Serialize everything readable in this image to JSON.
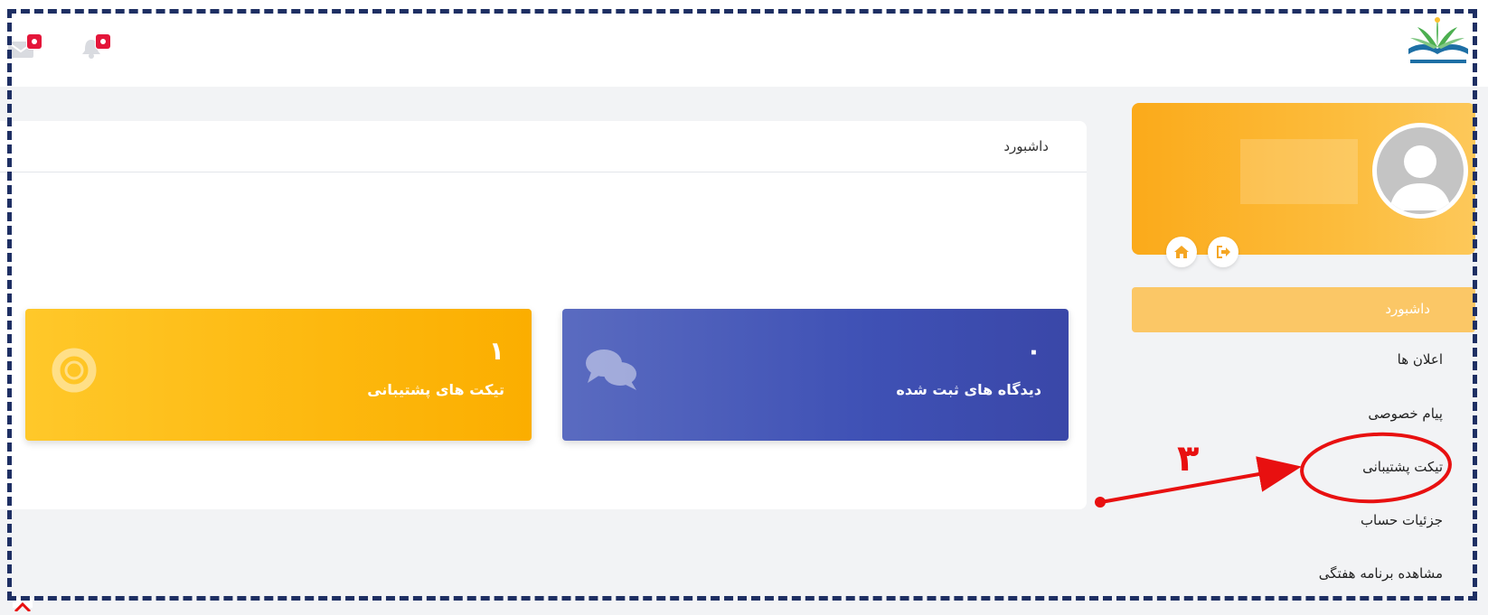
{
  "header": {
    "logo_icon": "school-logo",
    "mail_icon": "envelope-icon",
    "bell_icon": "bell-icon"
  },
  "main": {
    "title": "داشبورد",
    "stats": [
      {
        "count": "٠",
        "label": "دیدگاه های ثبت شده",
        "icon": "comments-icon",
        "color": "#3f51b5"
      },
      {
        "count": "١",
        "label": "تیکت های پشتیبانی",
        "icon": "life-ring-icon",
        "color": "#fdb80e"
      }
    ]
  },
  "sidebar": {
    "profile_color": "#fcb42c",
    "home_icon": "home-icon",
    "logout_icon": "sign-out-icon",
    "items": [
      {
        "label": "داشبورد",
        "active": true
      },
      {
        "label": "اعلان ها"
      },
      {
        "label": "پیام خصوصی"
      },
      {
        "label": "تیکت پشتیبانی"
      },
      {
        "label": "جزئیات حساب"
      },
      {
        "label": "مشاهده برنامه هفتگی"
      }
    ]
  },
  "annotation": {
    "step_number": "۳",
    "color": "#e81010"
  }
}
